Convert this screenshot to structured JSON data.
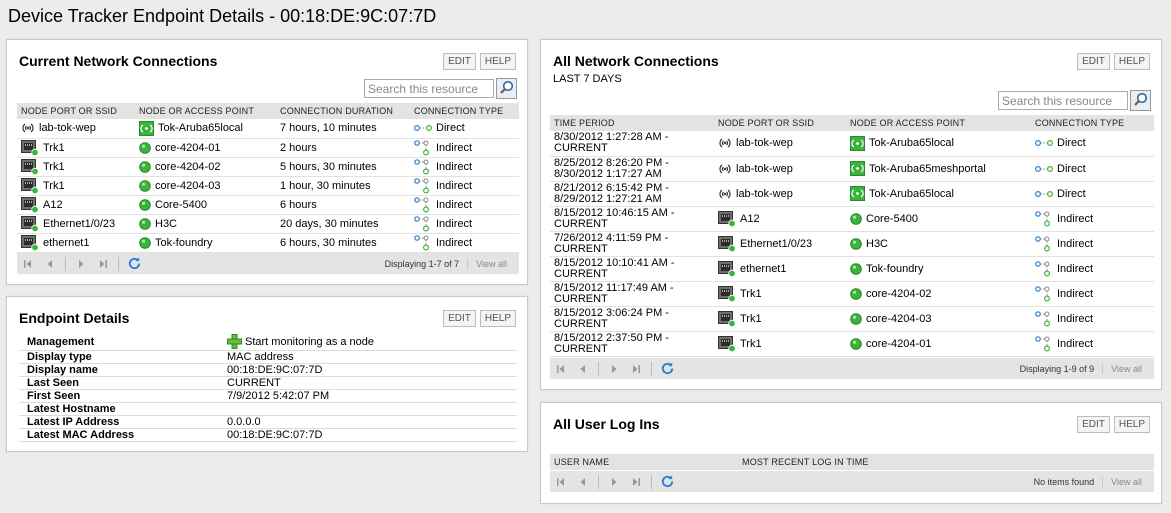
{
  "page_title": "Device Tracker Endpoint Details - 00:18:DE:9C:07:7D",
  "buttons": {
    "edit": "EDIT",
    "help": "HELP"
  },
  "search_placeholder": "Search this resource",
  "pager": {
    "first": "first-page-icon",
    "prev": "prev-page-icon",
    "next": "next-page-icon",
    "last": "last-page-icon",
    "refresh": "refresh-icon",
    "view_all": "View all"
  },
  "current": {
    "title": "Current Network Connections",
    "columns": [
      "NODE PORT OR SSID",
      "NODE OR ACCESS POINT",
      "CONNECTION DURATION",
      "CONNECTION TYPE"
    ],
    "rows": [
      {
        "port": "lab-tok-wep",
        "port_icon": "wireless-icon",
        "node": "Tok-Aruba65local",
        "node_icon": "access-point-icon",
        "duration": "7 hours, 10 minutes",
        "type": "Direct"
      },
      {
        "port": "Trk1",
        "port_icon": "ethernet-port-icon",
        "node": "core-4204-01",
        "node_icon": "node-up-icon",
        "duration": "2 hours",
        "type": "Indirect"
      },
      {
        "port": "Trk1",
        "port_icon": "ethernet-port-icon",
        "node": "core-4204-02",
        "node_icon": "node-up-icon",
        "duration": "5 hours, 30 minutes",
        "type": "Indirect"
      },
      {
        "port": "Trk1",
        "port_icon": "ethernet-port-icon",
        "node": "core-4204-03",
        "node_icon": "node-up-icon",
        "duration": "1 hour, 30 minutes",
        "type": "Indirect"
      },
      {
        "port": "A12",
        "port_icon": "ethernet-port-icon",
        "node": "Core-5400",
        "node_icon": "node-up-icon",
        "duration": "6 hours",
        "type": "Indirect"
      },
      {
        "port": "Ethernet1/0/23",
        "port_icon": "ethernet-port-icon",
        "node": "H3C",
        "node_icon": "node-up-icon",
        "duration": "20 days, 30 minutes",
        "type": "Indirect"
      },
      {
        "port": "ethernet1",
        "port_icon": "ethernet-port-icon",
        "node": "Tok-foundry",
        "node_icon": "node-up-icon",
        "duration": "6 hours, 30 minutes",
        "type": "Indirect"
      }
    ],
    "display": "Displaying 1-7 of 7"
  },
  "endpoint": {
    "title": "Endpoint Details",
    "rows": [
      {
        "key": "Management",
        "value": "Start monitoring as a node",
        "action": true
      },
      {
        "key": "Display type",
        "value": "MAC address"
      },
      {
        "key": "Display name",
        "value": "00:18:DE:9C:07:7D"
      },
      {
        "key": "Last Seen",
        "value": "CURRENT"
      },
      {
        "key": "First Seen",
        "value": "7/9/2012 5:42:07 PM"
      },
      {
        "key": "Latest Hostname",
        "value": ""
      },
      {
        "key": "Latest IP Address",
        "value": "0.0.0.0"
      },
      {
        "key": "Latest MAC Address",
        "value": "00:18:DE:9C:07:7D"
      }
    ]
  },
  "all": {
    "title": "All Network Connections",
    "subtitle": "LAST 7 DAYS",
    "columns": [
      "TIME PERIOD",
      "NODE PORT OR SSID",
      "NODE OR ACCESS POINT",
      "CONNECTION TYPE"
    ],
    "rows": [
      {
        "t1": "8/30/2012 1:27:28 AM -",
        "t2": "CURRENT",
        "port": "lab-tok-wep",
        "port_icon": "wireless-icon",
        "node": "Tok-Aruba65local",
        "node_icon": "access-point-icon",
        "type": "Direct"
      },
      {
        "t1": "8/25/2012 8:26:20 PM -",
        "t2": "8/30/2012 1:17:27 AM",
        "port": "lab-tok-wep",
        "port_icon": "wireless-icon",
        "node": "Tok-Aruba65meshportal",
        "node_icon": "access-point-icon",
        "type": "Direct"
      },
      {
        "t1": "8/21/2012 6:15:42 PM -",
        "t2": "8/29/2012 1:27:21 AM",
        "port": "lab-tok-wep",
        "port_icon": "wireless-icon",
        "node": "Tok-Aruba65local",
        "node_icon": "access-point-icon",
        "type": "Direct"
      },
      {
        "t1": "8/15/2012 10:46:15 AM -",
        "t2": "CURRENT",
        "port": "A12",
        "port_icon": "ethernet-port-icon",
        "node": "Core-5400",
        "node_icon": "node-up-icon",
        "type": "Indirect"
      },
      {
        "t1": "7/26/2012 4:11:59 PM -",
        "t2": "CURRENT",
        "port": "Ethernet1/0/23",
        "port_icon": "ethernet-port-icon",
        "node": "H3C",
        "node_icon": "node-up-icon",
        "type": "Indirect"
      },
      {
        "t1": "8/15/2012 10:10:41 AM -",
        "t2": "CURRENT",
        "port": "ethernet1",
        "port_icon": "ethernet-port-icon",
        "node": "Tok-foundry",
        "node_icon": "node-up-icon",
        "type": "Indirect"
      },
      {
        "t1": "8/15/2012 11:17:49 AM -",
        "t2": "CURRENT",
        "port": "Trk1",
        "port_icon": "ethernet-port-icon",
        "node": "core-4204-02",
        "node_icon": "node-up-icon",
        "type": "Indirect"
      },
      {
        "t1": "8/15/2012 3:06:24 PM -",
        "t2": "CURRENT",
        "port": "Trk1",
        "port_icon": "ethernet-port-icon",
        "node": "core-4204-03",
        "node_icon": "node-up-icon",
        "type": "Indirect"
      },
      {
        "t1": "8/15/2012 2:37:50 PM -",
        "t2": "CURRENT",
        "port": "Trk1",
        "port_icon": "ethernet-port-icon",
        "node": "core-4204-01",
        "node_icon": "node-up-icon",
        "type": "Indirect"
      }
    ],
    "display": "Displaying 1-9 of 9"
  },
  "logins": {
    "title": "All User Log Ins",
    "columns": [
      "USER NAME",
      "MOST RECENT LOG IN TIME"
    ],
    "display": "No items found"
  },
  "colors": {
    "node_up": "#3cb43c",
    "header_bg": "#e3e3e3",
    "pager_bg": "#e4e4e4",
    "refresh": "#2a7fd4"
  }
}
